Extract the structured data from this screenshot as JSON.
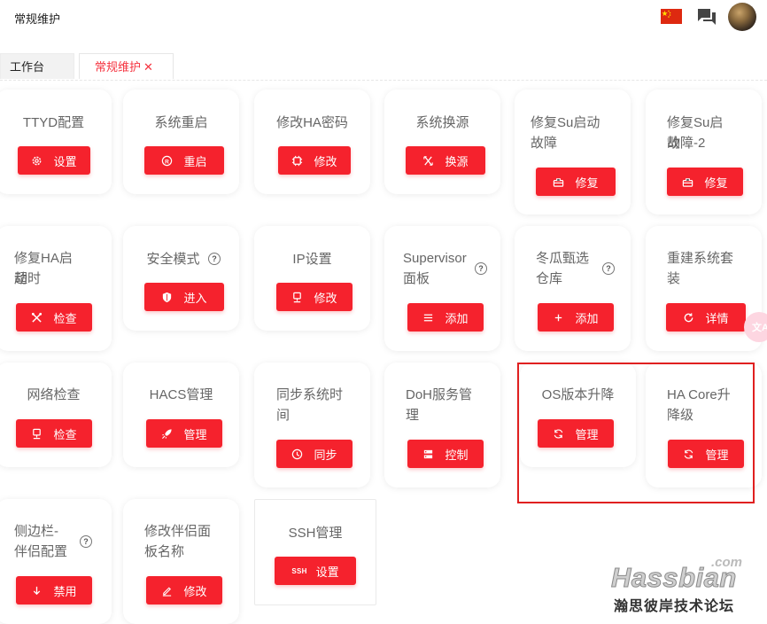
{
  "header": {
    "title": "常规维护"
  },
  "tabs": {
    "home": "工作台",
    "active": "常规维护",
    "close": "✕"
  },
  "cards": {
    "ttyd": {
      "title": "TTYD配置",
      "button": "设置"
    },
    "reboot": {
      "title": "系统重启",
      "button": "重启"
    },
    "ha_password": {
      "title": "修改HA密码",
      "button": "修改"
    },
    "source": {
      "title": "系统换源",
      "button": "换源"
    },
    "fix_su": {
      "title_line1": "修复Su启动",
      "title_line2": "故障",
      "button": "修复"
    },
    "fix_su2": {
      "title_line1": "修复Su启动",
      "title_line2": "故障-2",
      "button": "修复"
    },
    "fix_ha": {
      "title_line1": "修复HA启动",
      "title_line2": "超时",
      "button": "检查"
    },
    "safe_mode": {
      "title": "安全模式",
      "help": "?",
      "button": "进入"
    },
    "ip": {
      "title": "IP设置",
      "button": "修改"
    },
    "supervisor": {
      "title_line1": "Supervisor",
      "title_line2": "面板",
      "help": "?",
      "button": "添加"
    },
    "winter": {
      "title_line1": "冬瓜甄选",
      "title_line2": "仓库",
      "help": "?",
      "button": "添加"
    },
    "rebuild": {
      "title_line1": "重建系统套",
      "title_line2": "装",
      "button": "详情"
    },
    "network": {
      "title": "网络检查",
      "button": "检查"
    },
    "hacs": {
      "title": "HACS管理",
      "button": "管理"
    },
    "sync_time": {
      "title_line1": "同步系统时",
      "title_line2": "间",
      "button": "同步"
    },
    "doh": {
      "title_line1": "DoH服务管",
      "title_line2": "理",
      "button": "控制"
    },
    "os_upgrade": {
      "title": "OS版本升降",
      "button": "管理"
    },
    "ha_core": {
      "title_line1": "HA Core升",
      "title_line2": "降级",
      "button": "管理"
    },
    "sidebar": {
      "title_line1": "侧边栏-",
      "title_line2": "伴侣配置",
      "help": "?",
      "button": "禁用"
    },
    "panel_name": {
      "title_line1": "修改伴侣面",
      "title_line2": "板名称",
      "button": "修改"
    },
    "ssh": {
      "title": "SSH管理",
      "icon_text": "SSH",
      "button": "设置"
    }
  },
  "watermark": {
    "com": ".com",
    "name": "Hassbian",
    "cn": "瀚思彼岸技术论坛"
  },
  "side_float": {
    "label": "文A"
  },
  "colors": {
    "accent": "#f5222d",
    "highlight_border": "#e02020",
    "tab_active": "#f5333f"
  }
}
